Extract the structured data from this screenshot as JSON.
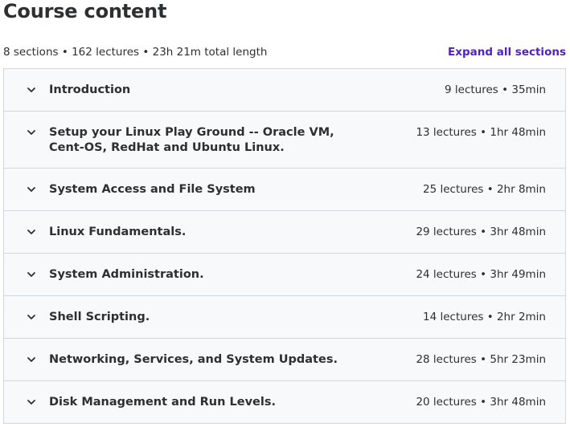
{
  "header": {
    "title": "Course content"
  },
  "summary": {
    "text": "8 sections • 162 lectures • 23h 21m total length",
    "expand_label": "Expand all sections"
  },
  "sections": [
    {
      "title": "Introduction",
      "meta": "9 lectures • 35min"
    },
    {
      "title": "Setup your Linux Play Ground -- Oracle VM, Cent-OS, RedHat and Ubuntu Linux.",
      "meta": "13 lectures • 1hr 48min"
    },
    {
      "title": "System Access and File System",
      "meta": "25 lectures • 2hr 8min"
    },
    {
      "title": "Linux Fundamentals.",
      "meta": "29 lectures • 3hr 48min"
    },
    {
      "title": "System Administration.",
      "meta": "24 lectures • 3hr 49min"
    },
    {
      "title": "Shell Scripting.",
      "meta": "14 lectures • 2hr 2min"
    },
    {
      "title": "Networking, Services, and System Updates.",
      "meta": "28 lectures • 5hr 23min"
    },
    {
      "title": "Disk Management and Run Levels.",
      "meta": "20 lectures • 3hr 48min"
    }
  ],
  "icons": {
    "section_toggle": "chevron-down-icon"
  },
  "colors": {
    "accent": "#5022c3",
    "section_bg": "#f7f9fa",
    "border": "#d1d7dc",
    "text": "#2d2f31"
  }
}
